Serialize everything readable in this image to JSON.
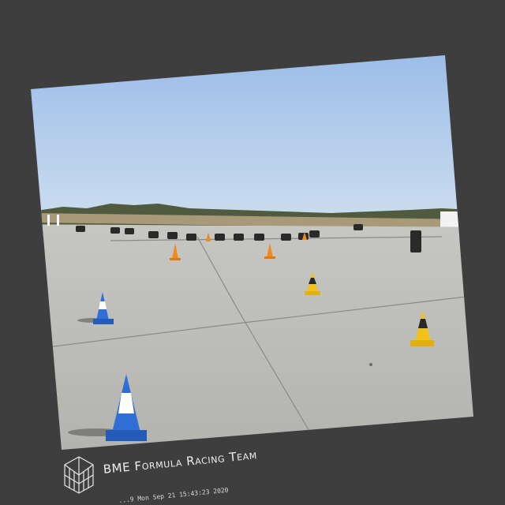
{
  "overlay": {
    "team_name": "BME Formula Racing Team",
    "timestamp": "...9 Mon Sep 21 15:43:23 2020",
    "logo_icon": "cube-lattice-icon"
  },
  "scene": {
    "subject": "autocross test track with traffic cones",
    "colors": {
      "background": "#3e3e3e",
      "sky_top": "#8fb4e6",
      "sky_bottom": "#cddff1",
      "asphalt": "#b5b5b1",
      "cone_blue": "#2f6fd6",
      "cone_yellow": "#f0c21a",
      "cone_orange": "#f08a1c"
    }
  }
}
